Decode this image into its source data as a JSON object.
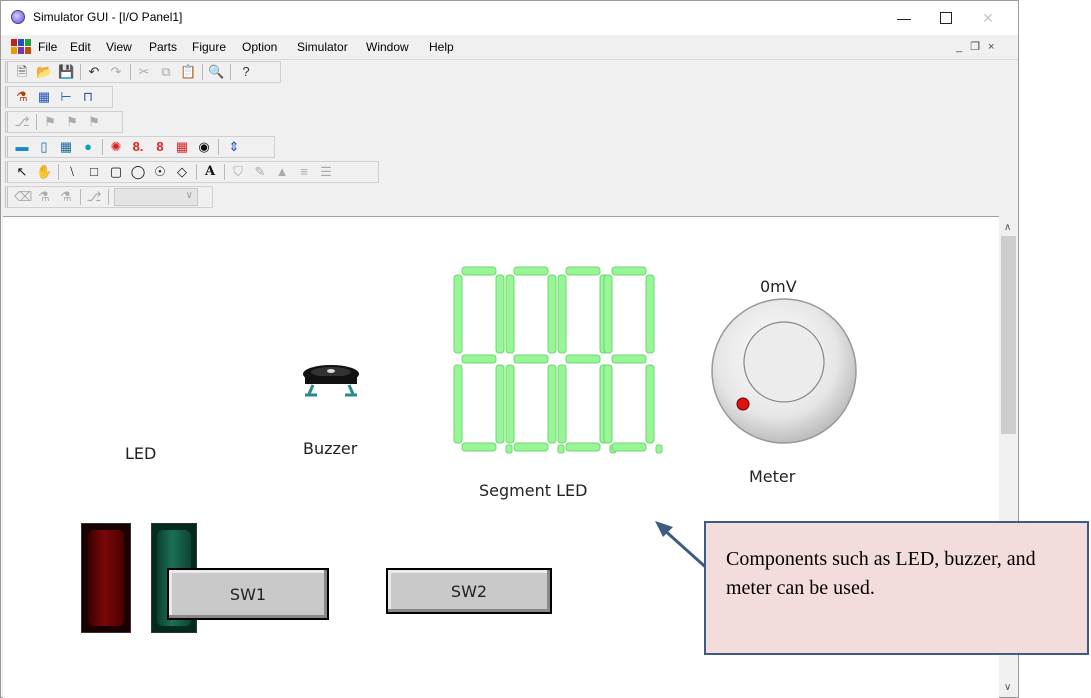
{
  "window": {
    "title": "Simulator GUI - [I/O Panel1]",
    "controls": [
      "minimize",
      "maximize",
      "close"
    ]
  },
  "menubar": {
    "items": [
      "File",
      "Edit",
      "View",
      "Parts",
      "Figure",
      "Option",
      "Simulator",
      "Window",
      "Help"
    ],
    "mdi_controls": "_ ×"
  },
  "panel": {
    "led_label": "LED",
    "buzzer_label": "Buzzer",
    "segment_label": "Segment LED",
    "meter_value": "0mV",
    "meter_label": "Meter",
    "sw1_label": "SW1",
    "sw2_label": "SW2"
  },
  "callout": {
    "text": "Components such as LED, buzzer, and meter can be used."
  },
  "colors": {
    "led_red": "#7a0808",
    "led_green": "#1d6f56",
    "segment": "#98f598",
    "callout_fill": "#f3dcdc",
    "callout_border": "#3e5b86"
  }
}
